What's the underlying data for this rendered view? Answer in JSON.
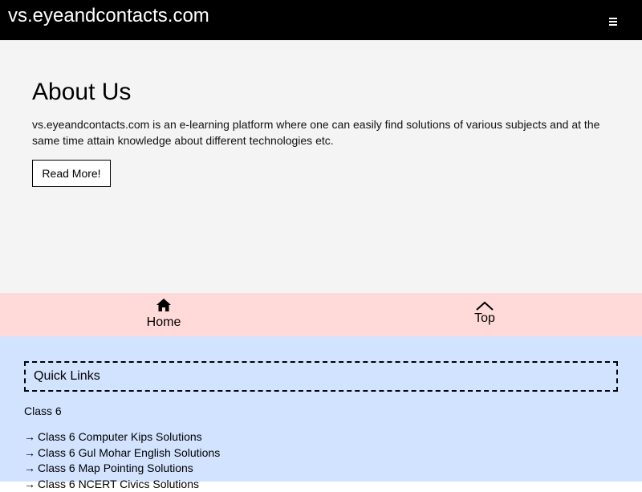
{
  "header": {
    "site_title": "vs.eyeandcontacts.com",
    "menu_icon": "hamburger-icon"
  },
  "about": {
    "heading": "About Us",
    "text": "vs.eyeandcontacts.com is an e-learning platform where one can easily find solutions of various subjects and at the same time attain knowledge about different technologies etc.",
    "button_label": "Read More!"
  },
  "bottom_nav": {
    "home_label": "Home",
    "home_icon": "home-icon",
    "top_label": "Top",
    "top_icon": "chevron-up-icon"
  },
  "footer": {
    "quick_links_title": "Quick Links",
    "class_heading": "Class 6",
    "arrow": "→",
    "links": [
      "Class 6 Computer Kips Solutions",
      "Class 6 Gul Mohar English Solutions",
      "Class 6 Map Pointing Solutions",
      "Class 6 NCERT Civics Solutions"
    ]
  },
  "colors": {
    "header_bg": "#000000",
    "about_bg": "#f4f4f4",
    "nav_bg": "#ffdad8",
    "footer_bg": "#d2e3ff"
  }
}
